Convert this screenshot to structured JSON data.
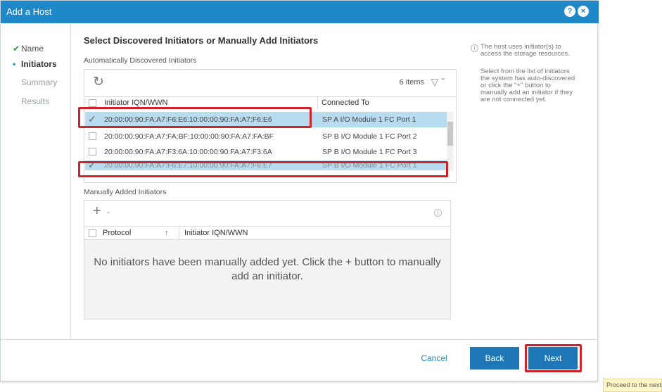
{
  "dialog": {
    "title": "Add a Host",
    "title_icons": [
      "help-icon",
      "close-icon"
    ]
  },
  "steps": [
    {
      "label": "Name",
      "state": "done",
      "marker": "✔"
    },
    {
      "label": "Initiators",
      "state": "current",
      "marker": "•"
    },
    {
      "label": "Summary",
      "state": "pending",
      "marker": ""
    },
    {
      "label": "Results",
      "state": "pending",
      "marker": ""
    }
  ],
  "main": {
    "heading": "Select Discovered Initiators or Manually Add Initiators",
    "auto_label": "Automatically Discovered Initiators",
    "auto_count": "6 items",
    "auto_columns": [
      "Initiator IQN/WWN",
      "Connected To"
    ],
    "auto_rows": [
      {
        "iqn": "20:00:00:90:FA:A7:F6:E6:10:00:00:90:FA:A7:F6:E6",
        "connected": "SP A I/O Module 1 FC Port 1",
        "checked": true
      },
      {
        "iqn": "20:00:00:90:FA:A7:FA:BF:10:00:00:90:FA:A7:FA:BF",
        "connected": "SP B I/O Module 1 FC Port 2",
        "checked": false
      },
      {
        "iqn": "20:00:00:90:FA:A7:F3:6A:10:00:00:90:FA:A7:F3:6A",
        "connected": "SP B I/O Module 1 FC Port 3",
        "checked": false
      },
      {
        "iqn": "20:00:00:90:FA:A7:F6:E7:10:00:00:90:FA:A7:F6:E7",
        "connected": "SP B I/O Module 1 FC Port 1",
        "checked": true
      }
    ],
    "manual_label": "Manually Added Initiators",
    "manual_columns": [
      "Protocol",
      "Initiator IQN/WWN"
    ],
    "manual_empty": "No initiators have been manually added yet. Click the + button to manually add an initiator."
  },
  "help": {
    "line1": "The host uses initiator(s) to",
    "line2": "access the storage resources.",
    "para": [
      "Select from the list of initiators",
      "the system has auto-discovered",
      "or click the \"+\" button to",
      "manually add an initiator if they",
      "are not connected yet."
    ]
  },
  "footer": {
    "cancel": "Cancel",
    "back": "Back",
    "next": "Next"
  },
  "tooltip": "Proceed to the next step",
  "colors": {
    "accent": "#1e88c9",
    "highlight": "#d2232a",
    "selected_row": "#b8dcef"
  }
}
